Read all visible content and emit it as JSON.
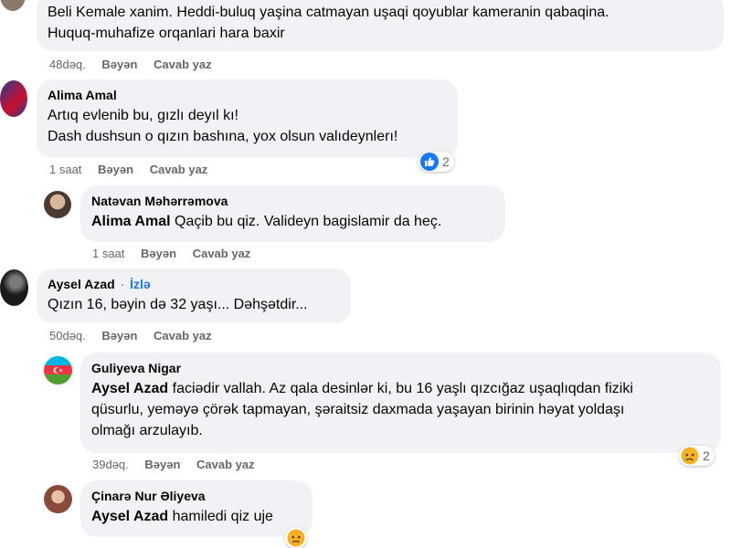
{
  "comments": [
    {
      "text_lines": [
        "Beli Kemale xanim. Heddi-buluq yaşina catmayan uşaqi qoyublar kameranin qabaqina.",
        "Huquq-muhafize orqanlari hara baxir"
      ],
      "time": "48dəq.",
      "like": "Bəyən",
      "reply": "Cavab yaz"
    },
    {
      "author": "Alima Amal",
      "text_lines": [
        "Artıq evlenib bu, gızlı deyıl kı!",
        "Dash dushsun o qızın bashına, yox olsun valıdeynlerı!"
      ],
      "time": "1 saat",
      "like": "Bəyən",
      "reply": "Cavab yaz",
      "reaction_count": "2"
    },
    {
      "author": "Natəvan Məhərrəmova",
      "mention": "Alima Amal",
      "text": " Qaçib bu qiz. Valideyn bagislamir da heç.",
      "time": "1 saat",
      "like": "Bəyən",
      "reply": "Cavab yaz"
    },
    {
      "author": "Aysel Azad",
      "separator": "·",
      "follow": "İzlə",
      "text": "Qızın 16, bəyin də 32 yaşı... Dəhşətdir...",
      "time": "50dəq.",
      "like": "Bəyən",
      "reply": "Cavab yaz"
    },
    {
      "author": "Guliyeva Nigar",
      "mention": "Aysel Azad",
      "text_first": " faciədir vallah. Az qala desinlər ki, bu 16 yaşlı qızcığaz uşaqlıqdan fiziki",
      "text_lines": [
        "qüsurlu, yeməyə çörək tapmayan, şəraitsiz daxmada yaşayan birinin həyat yoldaşı",
        "olmağı arzulayıb."
      ],
      "time": "39dəq.",
      "like": "Bəyən",
      "reply": "Cavab yaz",
      "reaction_count": "2"
    },
    {
      "author": "Çinarə Nur Əliyeva",
      "mention": "Aysel Azad",
      "text": " hamiledi qiz uje"
    }
  ],
  "colors": {
    "bubble": "#f0f2f5",
    "link": "#1877f2",
    "meta": "#65676b"
  },
  "icons": [
    "like-reaction-icon",
    "sad-reaction-icon"
  ]
}
